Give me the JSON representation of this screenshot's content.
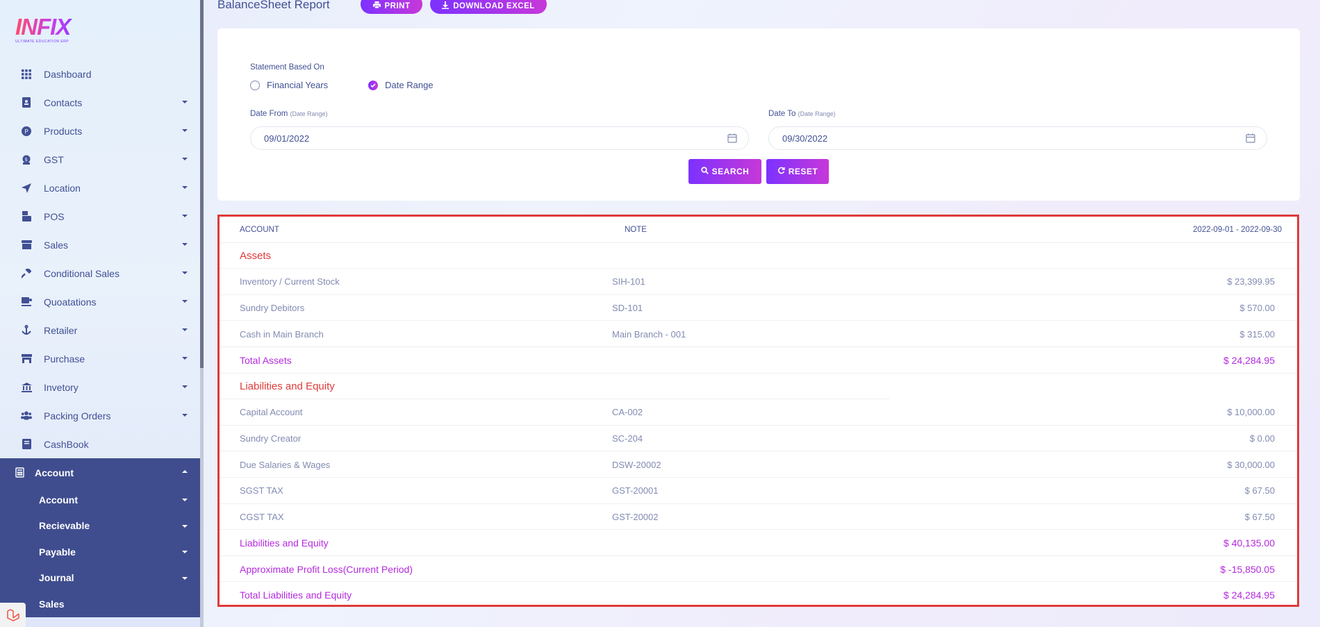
{
  "logo": {
    "word": "INFIX",
    "tagline": "ULTIMATE EDUCATION ERP"
  },
  "sidebar": {
    "items": [
      {
        "label": "Dashboard",
        "icon": "grid-icon",
        "has_caret": false
      },
      {
        "label": "Contacts",
        "icon": "contacts-book-icon",
        "has_caret": true
      },
      {
        "label": "Products",
        "icon": "product-circle-icon",
        "has_caret": true
      },
      {
        "label": "GST",
        "icon": "tax-icon",
        "has_caret": true
      },
      {
        "label": "Location",
        "icon": "location-arrow-icon",
        "has_caret": true
      },
      {
        "label": "POS",
        "icon": "pos-terminal-icon",
        "has_caret": true
      },
      {
        "label": "Sales",
        "icon": "store-icon",
        "has_caret": true
      },
      {
        "label": "Conditional Sales",
        "icon": "hammer-icon",
        "has_caret": true
      },
      {
        "label": "Quoatations",
        "icon": "cup-icon",
        "has_caret": true
      },
      {
        "label": "Retailer",
        "icon": "anchor-icon",
        "has_caret": true
      },
      {
        "label": "Purchase",
        "icon": "shop-icon",
        "has_caret": true
      },
      {
        "label": "Invetory",
        "icon": "bank-icon",
        "has_caret": true
      },
      {
        "label": "Packing Orders",
        "icon": "users-icon",
        "has_caret": true
      },
      {
        "label": "CashBook",
        "icon": "book-icon",
        "has_caret": false
      }
    ],
    "active": {
      "label": "Account",
      "icon": "calculator-icon"
    },
    "sub_items": [
      {
        "label": "Account",
        "has_caret": true
      },
      {
        "label": "Recievable",
        "has_caret": true
      },
      {
        "label": "Payable",
        "has_caret": true
      },
      {
        "label": "Journal",
        "has_caret": true
      },
      {
        "label": "Sales",
        "has_caret": false
      }
    ]
  },
  "header": {
    "title": "BalanceSheet Report",
    "print_label": "PRINT",
    "download_label": "DOWNLOAD EXCEL"
  },
  "filter": {
    "statement_label": "Statement Based On",
    "option_financial": "Financial Years",
    "option_range": "Date Range",
    "selected_option": "Date Range",
    "date_from_label": "Date From",
    "date_from_hint": "(Date Range)",
    "date_from_value": "09/01/2022",
    "date_to_label": "Date To",
    "date_to_hint": "(Date Range)",
    "date_to_value": "09/30/2022",
    "search_label": "SEARCH",
    "reset_label": "RESET"
  },
  "report": {
    "columns": {
      "account": "ACCOUNT",
      "note": "NOTE",
      "period": "2022-09-01 - 2022-09-30"
    },
    "assets_heading": "Assets",
    "assets": [
      {
        "account": "Inventory / Current Stock",
        "note": "SIH-101",
        "amount": "$ 23,399.95"
      },
      {
        "account": "Sundry Debitors",
        "note": "SD-101",
        "amount": "$ 570.00"
      },
      {
        "account": "Cash in Main Branch",
        "note": "Main Branch - 001",
        "amount": "$ 315.00"
      }
    ],
    "total_assets": {
      "label": "Total Assets",
      "amount": "$ 24,284.95"
    },
    "liabilities_heading": "Liabilities and Equity",
    "liabilities": [
      {
        "account": "Capital Account",
        "note": "CA-002",
        "amount": "$ 10,000.00"
      },
      {
        "account": "Sundry Creator",
        "note": "SC-204",
        "amount": "$ 0.00"
      },
      {
        "account": "Due Salaries & Wages",
        "note": "DSW-20002",
        "amount": "$ 30,000.00"
      },
      {
        "account": "SGST TAX",
        "note": "GST-20001",
        "amount": "$ 67.50"
      },
      {
        "account": "CGST TAX",
        "note": "GST-20002",
        "amount": "$ 67.50"
      }
    ],
    "liabilities_total": {
      "label": "Liabilities and Equity",
      "amount": "$ 40,135.00"
    },
    "profit_loss": {
      "label": "Approximate Profit Loss(Current Period)",
      "amount": "$ -15,850.05"
    },
    "total_liabilities": {
      "label": "Total Liabilities and Equity",
      "amount": "$ 24,284.95"
    }
  },
  "colors": {
    "primary_gradient_start": "#7c32ff",
    "primary_gradient_end": "#c738d8",
    "sidebar_active": "#3f4d8f",
    "section_heading": "#e03a3a",
    "totals": "#b42ae0",
    "text": "#415094"
  }
}
